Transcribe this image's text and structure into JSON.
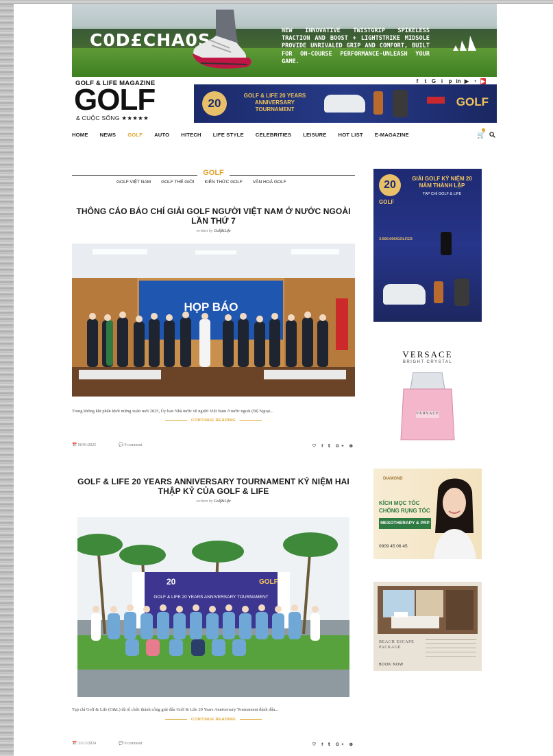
{
  "banner": {
    "brand": "C0D£CHA0S",
    "copy": "NEW INNOVATIVE TWISTGRIP SPIKELESS TRACTION AND BOOST + LIGHTSTRIKE MIDSOLE PROVIDE UNRIVALED GRIP AND COMFORT, BUILT FOR ON-COURSE PERFORMANCE-UNLEASH YOUR GAME."
  },
  "masthead": {
    "small": "GOLF & LIFE MAGAZINE",
    "big": "GOLF",
    "sub": "& CUỘC SỐNG ★★★★★"
  },
  "header_ad": {
    "number": "20",
    "text": "GOLF & LIFE 20 YEARS ANNIVERSARY TOURNAMENT",
    "logo": "GOLF"
  },
  "social_icons": [
    "f",
    "t",
    "G",
    "i",
    "p",
    "in",
    "yt",
    "rss",
    "y"
  ],
  "nav": {
    "items": [
      {
        "label": "HOME"
      },
      {
        "label": "NEWS"
      },
      {
        "label": "GOLF"
      },
      {
        "label": "AUTO"
      },
      {
        "label": "HITECH"
      },
      {
        "label": "LIFE STYLE"
      },
      {
        "label": "CELEBRITIES"
      },
      {
        "label": "LEISURE"
      },
      {
        "label": "HOT LIST"
      },
      {
        "label": "E-MAGAZINE"
      }
    ],
    "active": "GOLF"
  },
  "section": {
    "title": "GOLF",
    "subcats": [
      "GOLF VIỆT NAM",
      "GOLF THẾ GIỚI",
      "KIẾN THỨC GOLF",
      "VĂN HOÁ GOLF"
    ]
  },
  "posts": [
    {
      "title": "THÔNG CÁO BÁO CHÍ GIẢI GOLF NGƯỜI VIỆT NAM Ở NƯỚC NGOÀI LẦN THỨ 7",
      "byline_prefix": "written by",
      "byline_author": "Golf&Life",
      "photo_banner": "HỌP BÁO",
      "excerpt": "Trong không khí phấn khởi mừng xuân mới 2025, Ủy ban Nhà nước về người Việt Nam ở nước ngoài (Bộ Ngoại...",
      "continue": "CONTINUE READING",
      "date": "06/01/2025",
      "comments": "0 comment"
    },
    {
      "title": "GOLF & LIFE 20 YEARS ANNIVERSARY TOURNAMENT KỶ NIỆM HAI THẬP KỶ CỦA GOLF & LIFE",
      "byline_prefix": "written by",
      "byline_author": "Golf&Life",
      "photo_banner": "GOLF & LIFE 20 YEARS ANNIVERSARY TOURNAMENT",
      "excerpt": "Tạp chí Golf & Life (G&L) đã tổ chức thành công giải đấu Golf & Life 20 Years Anniversary Tournament đánh dấu...",
      "continue": "CONTINUE READING",
      "date": "31/12/2024",
      "comments": "0 comment"
    }
  ],
  "sidebar_ads": {
    "ad1": {
      "title": "GIẢI GOLF KỶ NIỆM 20 NĂM THÀNH LẬP",
      "sub": "TẠP CHÍ GOLF & LIFE",
      "logo": "GOLF",
      "price": "3.500.000/GOLFER"
    },
    "ad2": {
      "brand": "VERSACE",
      "sub": "BRIGHT CRYSTAL",
      "label": "VERSACE"
    },
    "ad3": {
      "brand": "DIAMOND",
      "line1": "KÍCH MỌC TÓC",
      "line2": "CHỐNG RỤNG TÓC",
      "line3": "MESOTHERAPY & PRP",
      "phone": "0909 45 06 45"
    },
    "ad4": {
      "title": "BEACH ESCAPE PACKAGE",
      "cta": "BOOK NOW"
    }
  }
}
